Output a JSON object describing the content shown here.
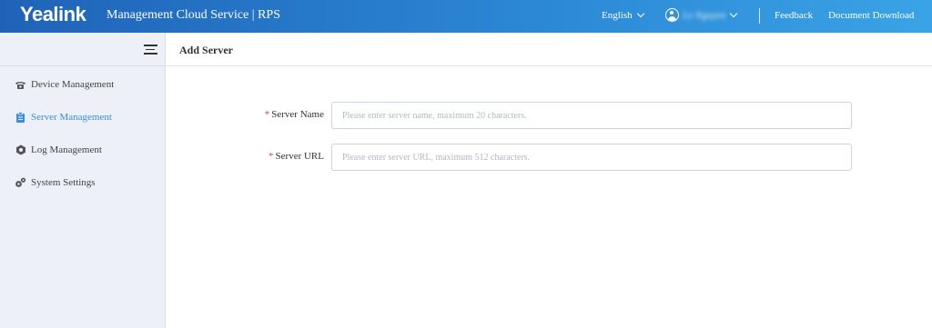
{
  "header": {
    "logo": "Yealink",
    "app_title": "Management Cloud Service | RPS",
    "language": "English",
    "username": "Le Nguyen",
    "feedback": "Feedback",
    "document_download": "Document Download"
  },
  "sidebar": {
    "items": [
      {
        "label": "Device Management",
        "icon": "phone-icon",
        "active": false
      },
      {
        "label": "Server Management",
        "icon": "clipboard-icon",
        "active": true
      },
      {
        "label": "Log Management",
        "icon": "hexagon-gear-icon",
        "active": false
      },
      {
        "label": "System Settings",
        "icon": "gears-icon",
        "active": false
      }
    ]
  },
  "page": {
    "title": "Add Server",
    "fields": [
      {
        "label": "Server Name",
        "required": true,
        "value": "",
        "placeholder": "Please enter server name, maximum 20 characters."
      },
      {
        "label": "Server URL",
        "required": true,
        "value": "",
        "placeholder": "Please enter server URL, maximum 512 characters."
      }
    ],
    "required_mark": "*"
  },
  "colors": {
    "header_gradient_start": "#1f63b8",
    "header_gradient_end": "#3aa3e6",
    "sidebar_bg": "#eef0f8",
    "active_nav": "#3a8ee0",
    "required_mark": "#e0454a"
  }
}
